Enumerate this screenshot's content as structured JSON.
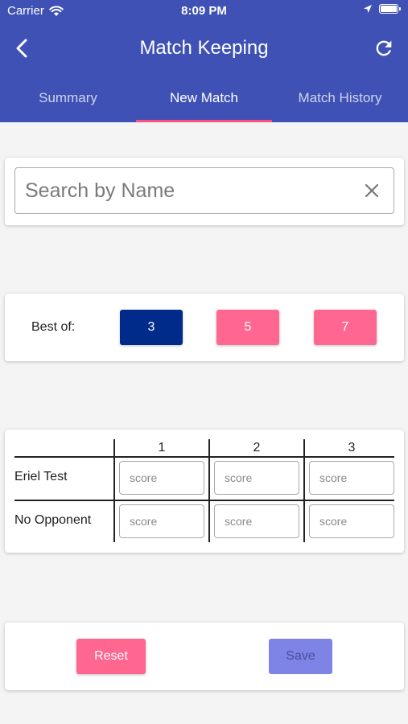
{
  "status_bar": {
    "carrier": "Carrier",
    "time": "8:09 PM"
  },
  "app_bar": {
    "title": "Match Keeping",
    "back_icon": "chevron-left-icon",
    "refresh_icon": "refresh-icon"
  },
  "tabs": [
    {
      "label": "Summary",
      "active": false
    },
    {
      "label": "New Match",
      "active": true
    },
    {
      "label": "Match History",
      "active": false
    }
  ],
  "search": {
    "placeholder": "Search by Name",
    "value": ""
  },
  "best_of": {
    "label": "Best of:",
    "options": [
      "3",
      "5",
      "7"
    ],
    "selected": "3"
  },
  "score_table": {
    "columns": [
      "1",
      "2",
      "3"
    ],
    "players": [
      "Eriel Test",
      "No Opponent"
    ],
    "score_placeholder": "score"
  },
  "actions": {
    "reset_label": "Reset",
    "save_label": "Save"
  },
  "colors": {
    "app_bar": "#3f51b5",
    "tab_indicator": "#ff4f7e",
    "selected_option": "#002b8a",
    "accent_pink": "#ff6690",
    "save_disabled": "#7e84e6"
  }
}
